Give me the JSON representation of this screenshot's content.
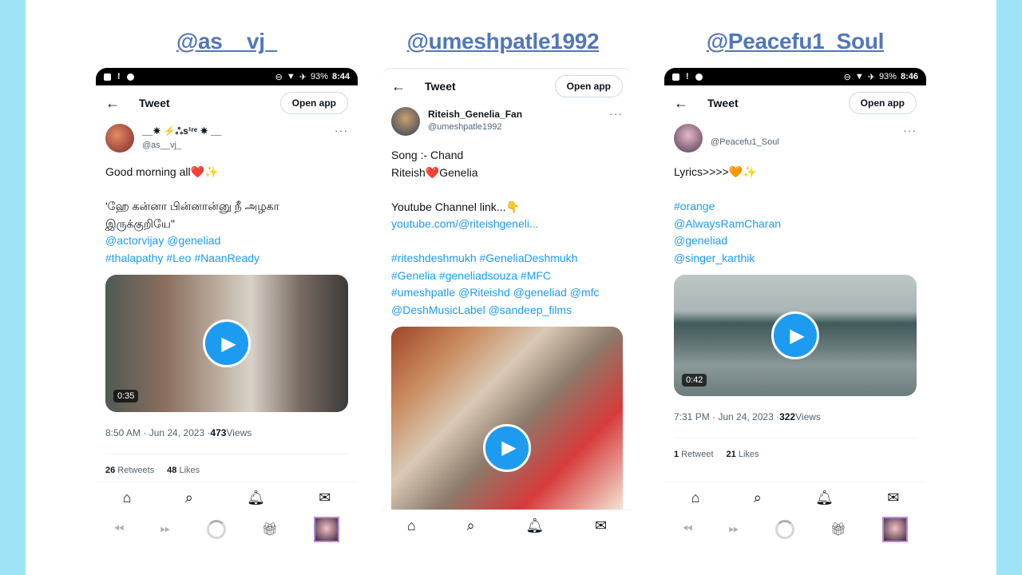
{
  "colors": {
    "background": "#9fe4f6",
    "handle": "#5177b8",
    "link": "#1d9bf0",
    "accent_play": "#1d9bf0"
  },
  "common": {
    "tweet_title": "Tweet",
    "open_app": "Open app",
    "more": "···",
    "back_icon": "arrow-left-icon"
  },
  "panels": [
    {
      "handle": "@as__vj_",
      "status": {
        "battery": "93%",
        "time": "8:44"
      },
      "display_name": "__✷ ⚡ஃs¹ʳᵉ ✷ __",
      "username": "@as__vj_",
      "lines": [
        "Good morning all❤️✨",
        "",
        "'ஹே கன்னா பின்னான்னு நீ அழகா",
        "இருக்குறியே\""
      ],
      "links": [
        "@actorvijay @geneliad",
        "#thalapathy #Leo #NaanReady"
      ],
      "duration": "0:35",
      "time": "8:50 AM · Jun 24, 2023 · ",
      "views_count": "473",
      "views_label": " Views",
      "retweets_count": "26",
      "retweets_label": " Retweets",
      "likes_count": "48",
      "likes_label": " Likes"
    },
    {
      "handle": "@umeshpatle1992",
      "display_name": "Riteish_Genelia_Fan",
      "username": "@umeshpatle1992",
      "lines": [
        "Song :- Chand",
        "Riteish❤️Genelia",
        "",
        "Youtube Channel link...👇"
      ],
      "links": [
        "youtube.com/@riteishgeneli...",
        "",
        "#riteshdeshmukh #GeneliaDeshmukh",
        "#Genelia #geneliadsouza #MFC",
        "#umeshpatle @Riteishd @geneliad @mfc",
        "@DeshMusicLabel @sandeep_films"
      ]
    },
    {
      "handle": "@Peacefu1_Soul",
      "status": {
        "battery": "93%",
        "time": "8:46"
      },
      "display_name": "",
      "username": "@Peacefu1_Soul",
      "lines": [
        "Lyrics>>>>🧡✨"
      ],
      "links": [
        "#orange",
        "@AlwaysRamCharan",
        "@geneliad",
        "@singer_karthik"
      ],
      "duration": "0:42",
      "time": "7:31 PM · Jun 24, 2023 · ",
      "views_count": "322",
      "views_label": " Views",
      "retweets_count": "1",
      "retweets_label": " Retweet",
      "likes_count": "21",
      "likes_label": " Likes"
    }
  ],
  "tabbar": {
    "home": "⌂",
    "search": "⌕",
    "notifications": "🔔︎",
    "messages": "✉"
  },
  "navbar": {
    "rewind": "⏪︎",
    "forward": "⏩︎",
    "gift": "🎁︎"
  }
}
